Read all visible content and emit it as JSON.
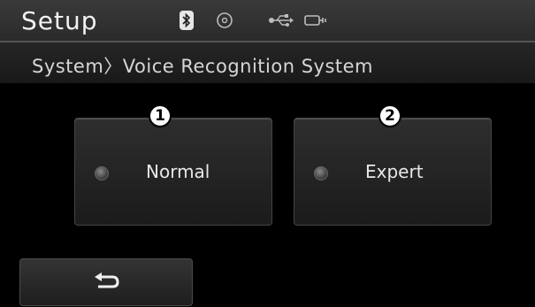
{
  "header": {
    "title": "Setup",
    "icons": [
      "bluetooth-icon",
      "disc-icon",
      "usb-icon",
      "aux-icon"
    ]
  },
  "breadcrumb": {
    "text": "System〉Voice Recognition System"
  },
  "options": [
    {
      "label": "Normal",
      "callout": "1",
      "selected": false
    },
    {
      "label": "Expert",
      "callout": "2",
      "selected": false
    }
  ],
  "footer": {
    "back_icon": "back-arrow-icon"
  },
  "colors": {
    "background": "#000000",
    "text": "#e8e8e8"
  }
}
